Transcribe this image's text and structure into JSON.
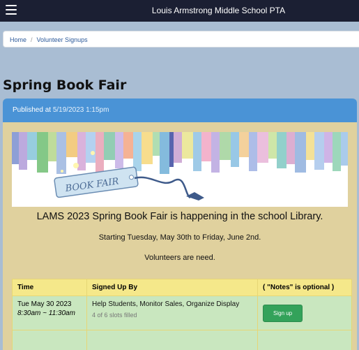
{
  "header": {
    "title": "Louis Armstrong Middle School PTA"
  },
  "breadcrumb": {
    "home": "Home",
    "separator": "/",
    "current": "Volunteer Signups"
  },
  "page": {
    "title": "Spring Book Fair"
  },
  "post": {
    "published_label": "Published at",
    "published_at": "5/19/2023 1:15pm",
    "banner_text": "BOOK FAIR",
    "intro_line1": "LAMS 2023 Spring Book Fair is happening in the school Library.",
    "intro_line2": "Starting Tuesday, May 30th to Friday, June 2nd.",
    "intro_line3": "Volunteers are need."
  },
  "table": {
    "headers": {
      "time": "Time",
      "signed_up_by": "Signed Up By",
      "notes": "( \"Notes\" is optional )"
    },
    "rows": [
      {
        "date": "Tue May 30 2023",
        "time": "8:30am ~ 11:30am",
        "role": "Help Students, Monitor Sales, Organize Display",
        "filled": "4 of 6 slots filled",
        "action": "Sign up"
      }
    ]
  },
  "colors": {
    "topbar": "#1b1f33",
    "page_bg": "#a9bdd3",
    "card_header": "#4a93d6",
    "card_body": "#e0d19e",
    "table_header": "#f5e88a",
    "row_bg": "#c9e7bf",
    "signup_button": "#33a25a"
  },
  "icons": {
    "menu": "hamburger-menu-icon"
  }
}
